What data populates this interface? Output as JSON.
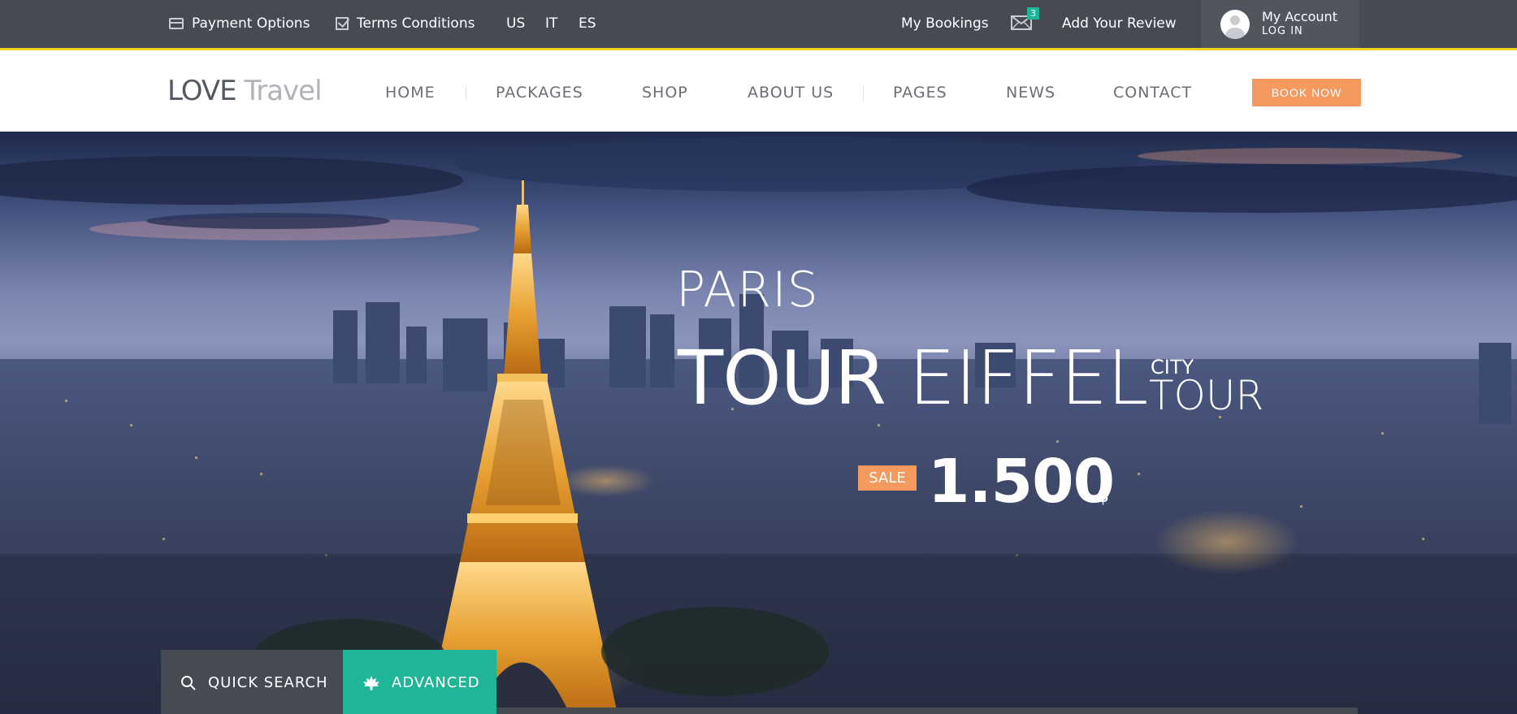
{
  "topbar": {
    "payment_options": "Payment Options",
    "terms_conditions": "Terms Conditions",
    "languages": [
      "US",
      "IT",
      "ES"
    ],
    "my_bookings": "My Bookings",
    "mail_count": "3",
    "add_review": "Add Your Review",
    "account_title": "My Account",
    "account_login": "LOG IN",
    "accent_color": "#f2cf1c"
  },
  "header": {
    "logo_part1": "LOVE",
    "logo_part2": "Travel",
    "nav": [
      "HOME",
      "PACKAGES",
      "SHOP",
      "ABOUT US",
      "PAGES",
      "NEWS",
      "CONTACT"
    ],
    "book_now": "BOOK NOW",
    "book_color": "#f49a5f"
  },
  "hero": {
    "city": "PARIS",
    "title_bold": "TOUR",
    "title_light": "EIFFEL",
    "subtitle_small": "CITY",
    "subtitle_large": "TOUR",
    "sale_label": "SALE",
    "price": "1.500",
    "currency": "$"
  },
  "search": {
    "quick_search": "QUICK SEARCH",
    "advanced": "ADVANCED",
    "advanced_color": "#1fb698"
  }
}
